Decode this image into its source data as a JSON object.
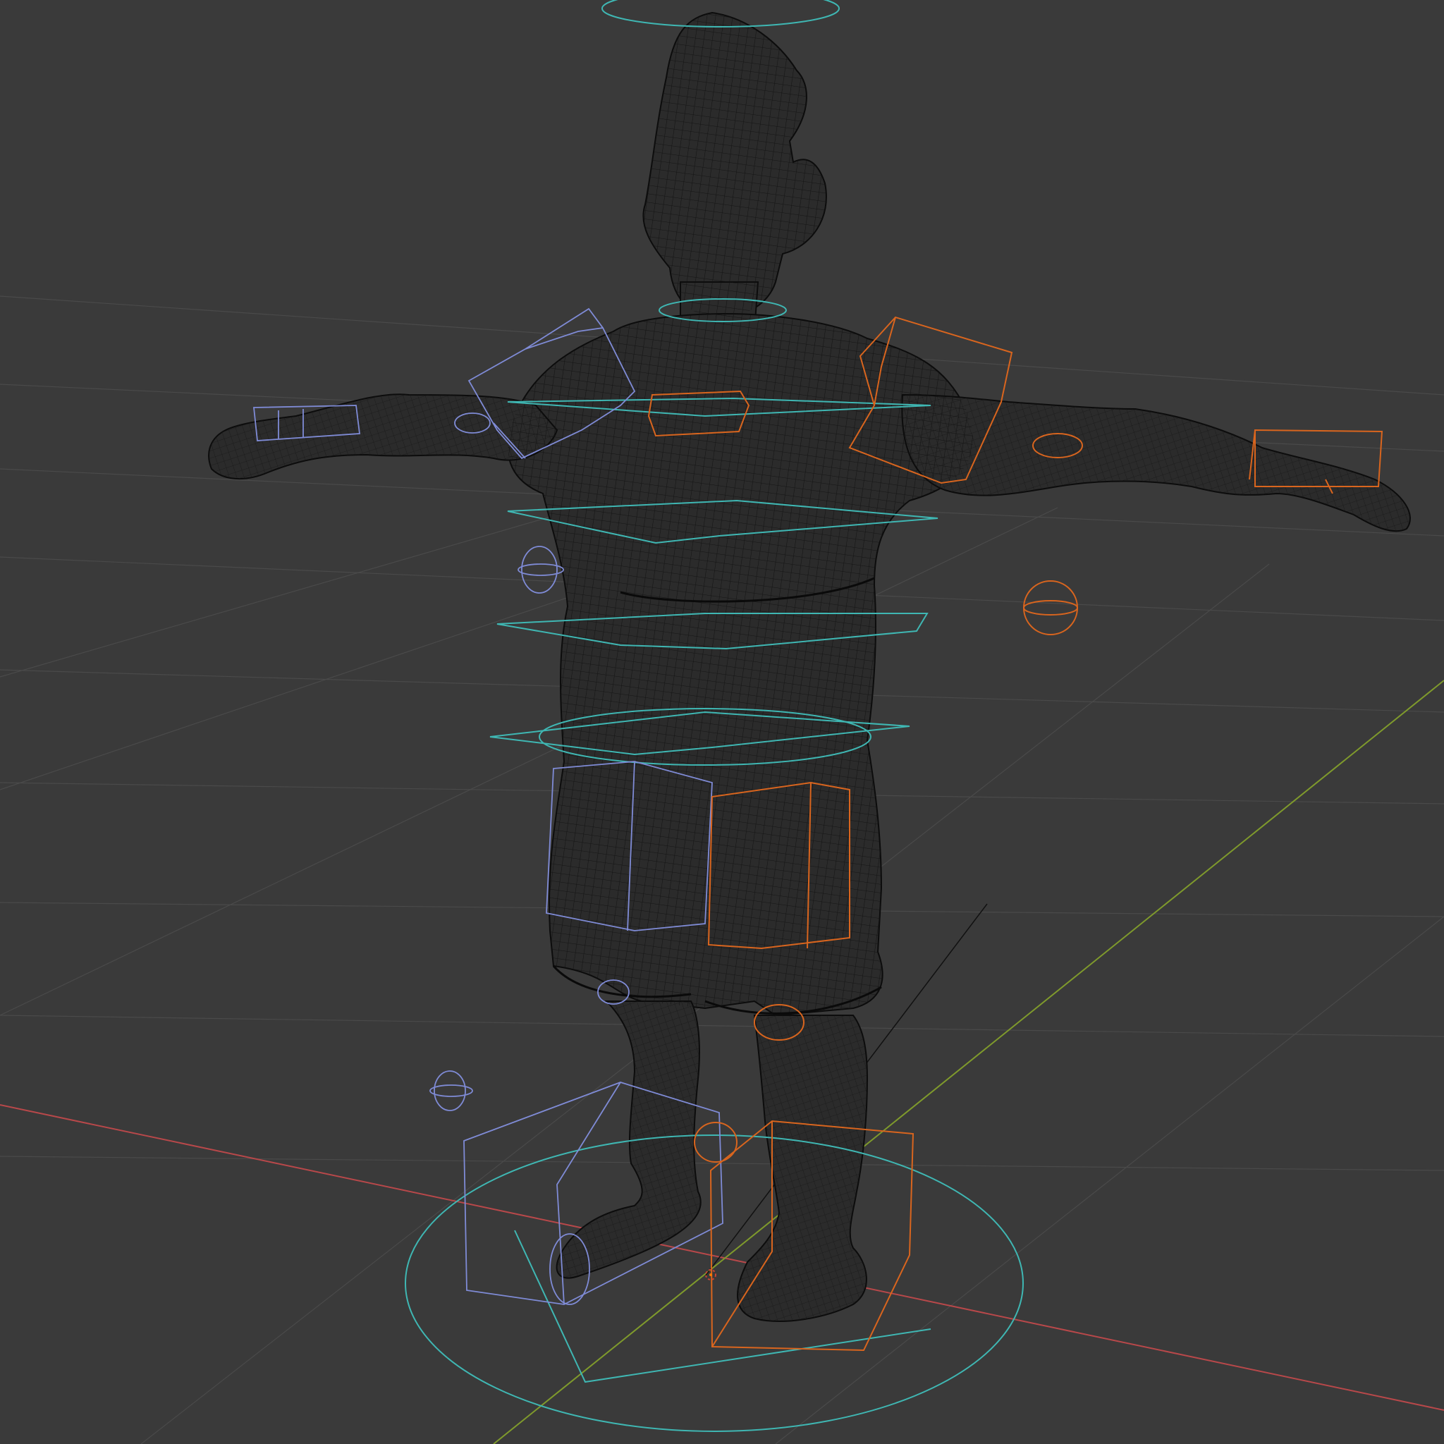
{
  "viewport": {
    "mode": "wireframe",
    "background_color": "#3a3a3a",
    "grid_color": "#4a4a4a",
    "x_axis_color": "#b8484a",
    "y_axis_color": "#7f9a2c",
    "mesh_color": "#111111",
    "control_colors": {
      "center": "#3fb7b3",
      "left": "#7f8bd6",
      "right": "#d9651e"
    }
  },
  "scene_objects": {
    "mesh": "character-body-mesh",
    "armature_controls": [
      "head-top-ring",
      "neck-ring",
      "chest-ring",
      "spine-ring",
      "waist-ring",
      "hip-ring",
      "root-circle",
      "left-shoulder-box",
      "right-shoulder-box",
      "left-hand-box",
      "right-hand-box",
      "left-thigh-box",
      "right-thigh-box",
      "left-foot-box",
      "right-foot-box",
      "left-elbow-pole",
      "right-elbow-pole",
      "left-knee-pole",
      "right-knee-pole"
    ],
    "origin_marker": "3d-cursor"
  }
}
